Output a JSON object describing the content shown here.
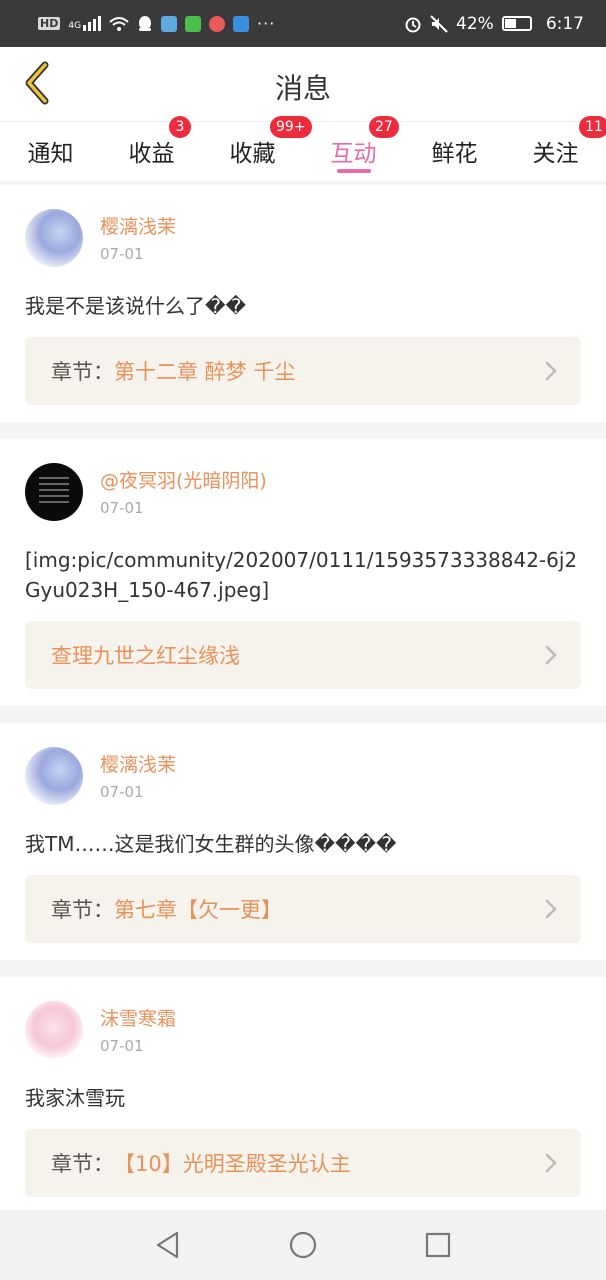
{
  "status_bar": {
    "left_labels": [
      "HD",
      "4G"
    ],
    "battery_percent": "42%",
    "battery_level": 0.42,
    "time": "6:17",
    "icons": [
      "hd-icon",
      "signal-icon",
      "wifi-icon",
      "qq-icon",
      "app-icon",
      "iqiyi-icon",
      "browser-icon",
      "message-app-icon",
      "more-icon",
      "alarm-icon",
      "mute-icon",
      "battery-icon"
    ]
  },
  "header": {
    "title": "消息",
    "back_icon": "chevron-left-icon"
  },
  "tabs": [
    {
      "label": "通知",
      "badge": ""
    },
    {
      "label": "收益",
      "badge": "3"
    },
    {
      "label": "收藏",
      "badge": "99+"
    },
    {
      "label": "互动",
      "badge": "27",
      "active": true
    },
    {
      "label": "鲜花",
      "badge": ""
    },
    {
      "label": "关注",
      "badge": "11"
    }
  ],
  "posts": [
    {
      "user": "樱漓浅茉",
      "date": "07-01",
      "content": "我是不是该说什么了��",
      "link_label": "章节：",
      "link_title": "第十二章 醉梦 千尘"
    },
    {
      "user": "@夜冥羽(光暗阴阳)",
      "date": "07-01",
      "content": "[img:pic/community/202007/0111/1593573338842-6j2Gyu023H_150-467.jpeg]",
      "link_label": "",
      "link_title": "查理九世之红尘缘浅"
    },
    {
      "user": "樱漓浅茉",
      "date": "07-01",
      "content": "我TM……这是我们女生群的头像����",
      "link_label": "章节：",
      "link_title": "第七章【欠一更】"
    },
    {
      "user": "沫雪寒霜",
      "date": "07-01",
      "content": "我家沐雪玩",
      "link_label": "章节：",
      "link_title": "【10】光明圣殿圣光认主"
    }
  ],
  "colors": {
    "accent": "#e86aa8",
    "name": "#e8915a",
    "badge": "#ec2b3c",
    "link_bg": "#f5f3ec"
  }
}
